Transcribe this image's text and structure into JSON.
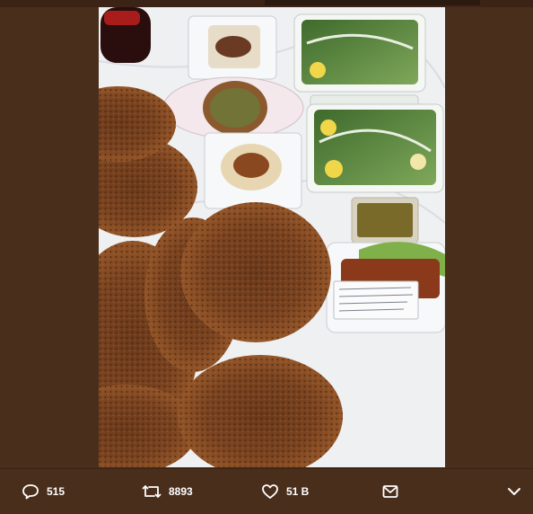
{
  "tweet": {
    "media": {
      "alt": ""
    },
    "actions": {
      "replies": "515",
      "retweets": "8893",
      "likes": "51 B"
    }
  },
  "colors": {
    "background": "#4a2e1c",
    "text": "#ffffff"
  },
  "icons": [
    "reply-icon",
    "retweet-icon",
    "like-icon",
    "share-icon",
    "chevron-down-icon"
  ]
}
